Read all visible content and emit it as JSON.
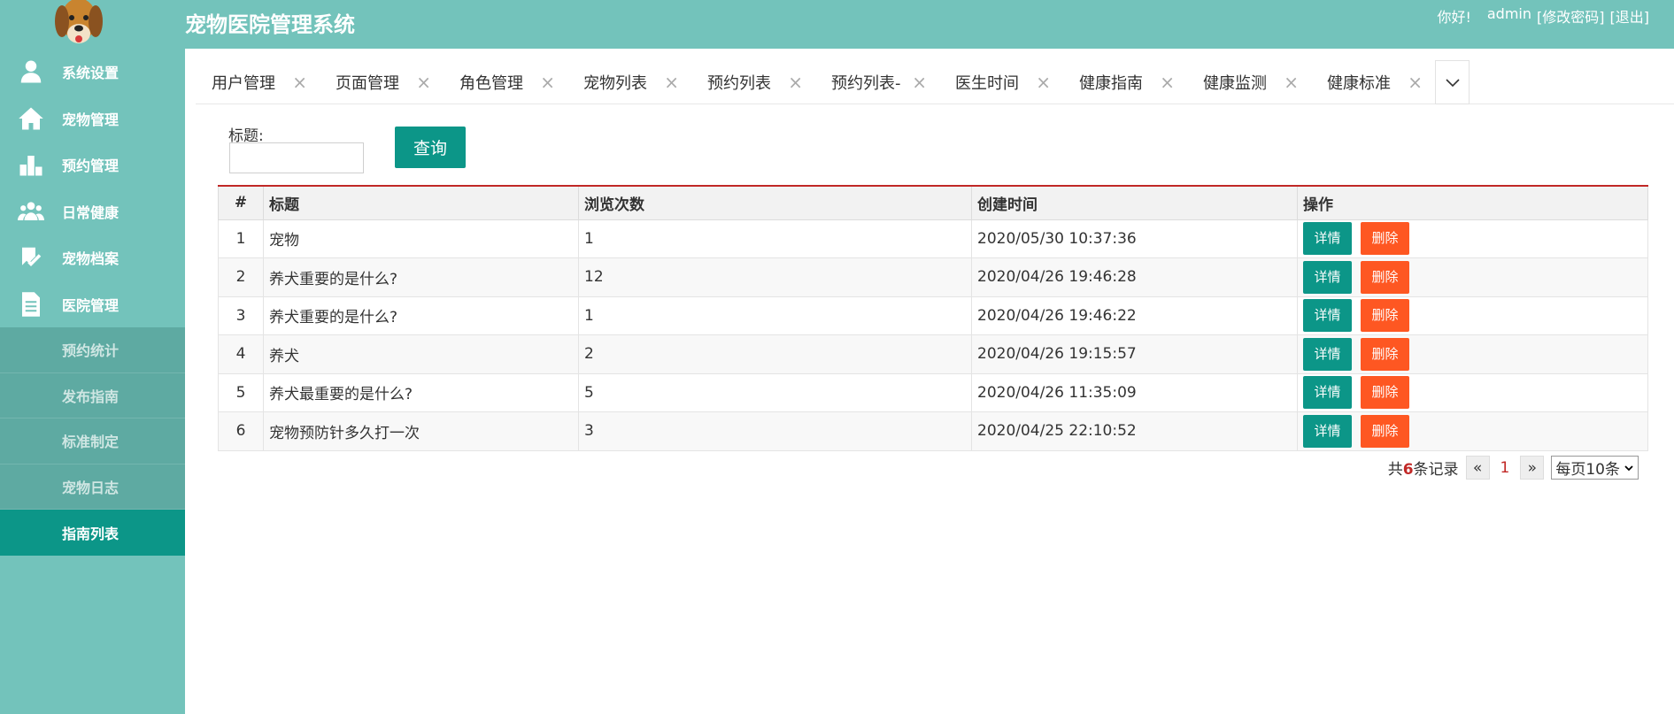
{
  "header": {
    "title": "宠物医院管理系统",
    "greeting": "你好!",
    "username": "admin",
    "change_password": "[修改密码]",
    "logout": "[退出]"
  },
  "sidebar": {
    "items": [
      {
        "label": "系统设置",
        "icon": "user-icon"
      },
      {
        "label": "宠物管理",
        "icon": "home-icon"
      },
      {
        "label": "预约管理",
        "icon": "bar-chart-icon"
      },
      {
        "label": "日常健康",
        "icon": "group-icon"
      },
      {
        "label": "宠物档案",
        "icon": "check-icon"
      },
      {
        "label": "医院管理",
        "icon": "document-icon"
      }
    ],
    "sub_items": [
      {
        "label": "预约统计"
      },
      {
        "label": "发布指南"
      },
      {
        "label": "标准制定"
      },
      {
        "label": "宠物日志"
      },
      {
        "label": "指南列表"
      }
    ]
  },
  "tabs": [
    {
      "label": "用户管理"
    },
    {
      "label": "页面管理"
    },
    {
      "label": "角色管理"
    },
    {
      "label": "宠物列表"
    },
    {
      "label": "预约列表"
    },
    {
      "label": "预约列表-"
    },
    {
      "label": "医生时间"
    },
    {
      "label": "健康指南"
    },
    {
      "label": "健康监测"
    },
    {
      "label": "健康标准"
    }
  ],
  "tab_close_glyph": "×",
  "search": {
    "label": "标题:",
    "value": "",
    "button": "查询"
  },
  "table": {
    "headers": [
      "#",
      "标题",
      "浏览次数",
      "创建时间",
      "操作"
    ],
    "rows": [
      {
        "id": "1",
        "title": "宠物",
        "views": "1",
        "created": "2020/05/30 10:37:36"
      },
      {
        "id": "2",
        "title": "养犬重要的是什么?",
        "views": "12",
        "created": "2020/04/26 19:46:28"
      },
      {
        "id": "3",
        "title": "养犬重要的是什么?",
        "views": "1",
        "created": "2020/04/26 19:46:22"
      },
      {
        "id": "4",
        "title": "养犬",
        "views": "2",
        "created": "2020/04/26 19:15:57"
      },
      {
        "id": "5",
        "title": "养犬最重要的是什么?",
        "views": "5",
        "created": "2020/04/26 11:35:09"
      },
      {
        "id": "6",
        "title": "宠物预防针多久打一次",
        "views": "3",
        "created": "2020/04/25 22:10:52"
      }
    ],
    "detail_label": "详情",
    "delete_label": "删除"
  },
  "pager": {
    "prefix": "共",
    "total": "6",
    "suffix": "条记录",
    "prev": "«",
    "page": "1",
    "next": "»",
    "per_page": "每页10条"
  },
  "colors": {
    "theme": "#73c3bb",
    "primary": "#0c9688",
    "danger": "#fe5722",
    "accent_line": "#c12826"
  }
}
